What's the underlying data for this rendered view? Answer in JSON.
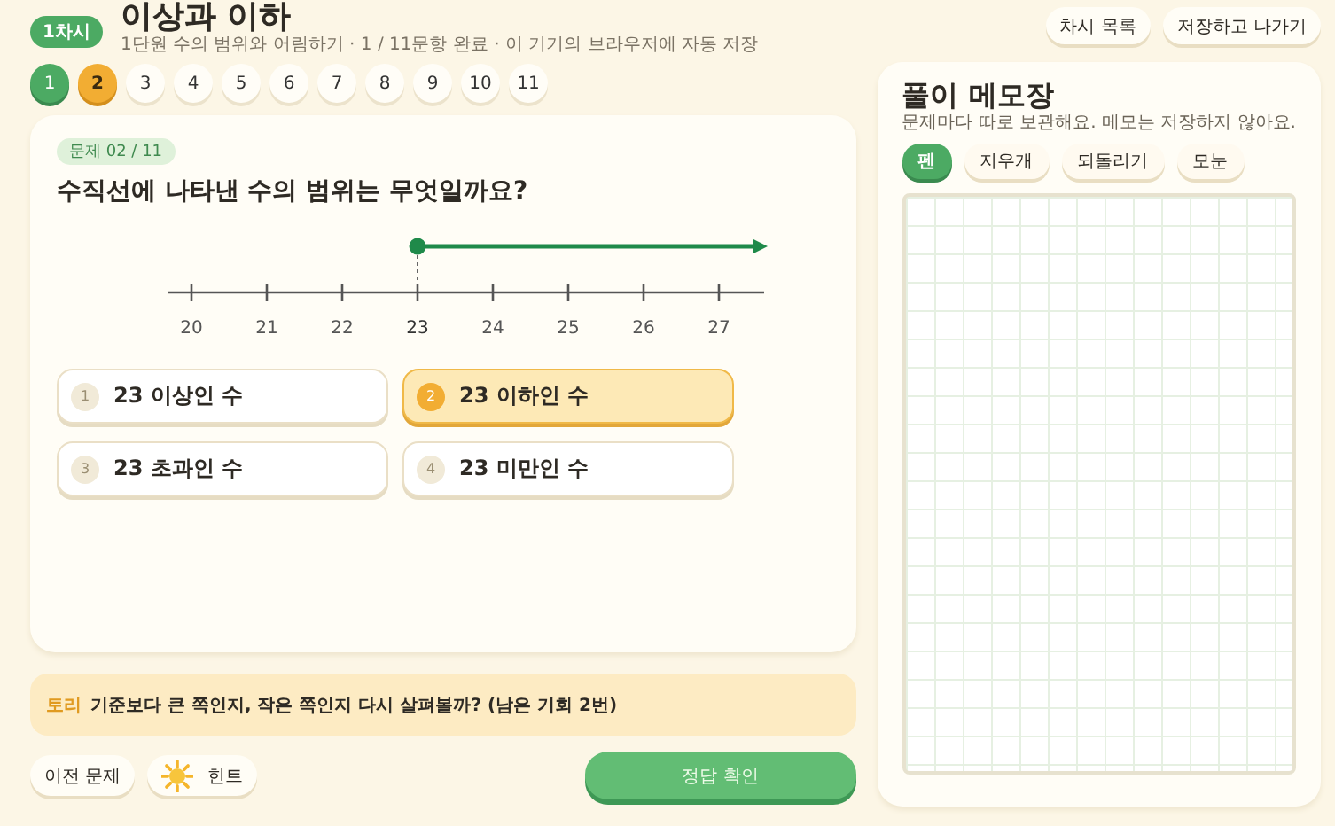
{
  "header": {
    "badge": "1차시",
    "title": "이상과 이하",
    "subtitle": "1단원 수의 범위와 어림하기 · 1 / 11문항 완료 · 이 기기의 브라우저에 자동 저장"
  },
  "top_buttons": [
    "차시 목록",
    "저장하고 나가기"
  ],
  "question_nav": [
    {
      "label": "1",
      "done": true,
      "selected": false
    },
    {
      "label": "2",
      "done": false,
      "selected": true
    },
    {
      "label": "3",
      "done": false,
      "selected": false
    },
    {
      "label": "4",
      "done": false,
      "selected": false
    },
    {
      "label": "5",
      "done": false,
      "selected": false
    },
    {
      "label": "6",
      "done": false,
      "selected": false
    },
    {
      "label": "7",
      "done": false,
      "selected": false
    },
    {
      "label": "8",
      "done": false,
      "selected": false
    },
    {
      "label": "9",
      "done": false,
      "selected": false
    },
    {
      "label": "10",
      "done": false,
      "selected": false
    },
    {
      "label": "11",
      "done": false,
      "selected": false
    }
  ],
  "question": {
    "badge": "문제 02 / 11",
    "text": "수직선에 나타낸 수의 범위는 무엇일까요?",
    "number_line": {
      "ray_to_right": true,
      "endpoint_filled": true,
      "ticks": [
        {
          "label": "20",
          "marked": false
        },
        {
          "label": "21",
          "marked": false
        },
        {
          "label": "22",
          "marked": false
        },
        {
          "label": "23",
          "marked": true
        },
        {
          "label": "24",
          "marked": false
        },
        {
          "label": "25",
          "marked": false
        },
        {
          "label": "26",
          "marked": false
        },
        {
          "label": "27",
          "marked": false
        }
      ]
    },
    "options": [
      {
        "number": "1",
        "text": "23 이상인 수",
        "selected": false
      },
      {
        "number": "2",
        "text": "23 이하인 수",
        "selected": true
      },
      {
        "number": "3",
        "text": "23 초과인 수",
        "selected": false
      },
      {
        "number": "4",
        "text": "23 미만인 수",
        "selected": false
      }
    ]
  },
  "hint": {
    "speaker": "토리",
    "text": "기준보다 큰 쪽인지, 작은 쪽인지 다시 살펴볼까? (남은 기회 2번)"
  },
  "bottom_buttons": [
    {
      "label": "이전 문제",
      "kind": "plain"
    },
    {
      "label": "힌트",
      "kind": "hint"
    }
  ],
  "submit": "정답 확인",
  "memo": {
    "title": "풀이 메모장",
    "subtitle": "문제마다 따로 보관해요. 메모는 저장하지 않아요.",
    "tools": [
      {
        "label": "펜",
        "selected": true
      },
      {
        "label": "지우개",
        "selected": false
      },
      {
        "label": "되돌리기",
        "selected": false
      },
      {
        "label": "모눈",
        "selected": false
      }
    ]
  }
}
